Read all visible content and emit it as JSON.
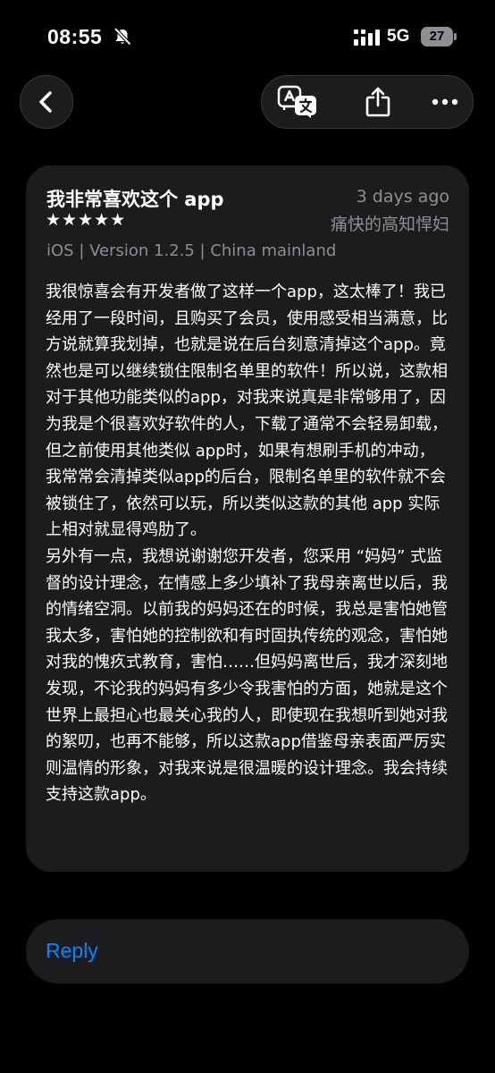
{
  "status_bar": {
    "time": "08:55",
    "network": "5G",
    "battery": "27"
  },
  "review": {
    "title": "我非常喜欢这个 app",
    "date": "3 days ago",
    "stars": "★★★★★",
    "rating": 5,
    "author": "痛快的高知悍妇",
    "meta": "iOS | Version 1.2.5 | China mainland",
    "paragraphs": [
      "我很惊喜会有开发者做了这样一个app，这太棒了！我已经用了一段时间，且购买了会员，使用感受相当满意，比方说就算我划掉，也就是说在后台刻意清掉这个app。竟然也是可以继续锁住限制名单里的软件！所以说，这款相对于其他功能类似的app，对我来说真是非常够用了，因为我是个很喜欢好软件的人，下载了通常不会轻易卸载，但之前使用其他类似 app时，如果有想刷手机的冲动，我常常会清掉类似app的后台，限制名单里的软件就不会被锁住了，依然可以玩，所以类似这款的其他 app 实际上相对就显得鸡肋了。",
      "另外有一点，我想说谢谢您开发者，您采用 “妈妈” 式监督的设计理念，在情感上多少填补了我母亲离世以后，我的情绪空洞。以前我的妈妈还在的时候，我总是害怕她管我太多，害怕她的控制欲和有时固执传统的观念，害怕她对我的愧疚式教育，害怕……但妈妈离世后，我才深刻地发现，不论我的妈妈有多少令我害怕的方面，她就是这个世界上最担心也最关心我的人，即使现在我想听到她对我的絮叨，也再不能够，所以这款app借鉴母亲表面严厉实则温情的形象，对我来说是很温暖的设计理念。我会持续支持这款app。"
    ]
  },
  "reply": {
    "label": "Reply"
  },
  "icons": {
    "back": "chevron-left-icon",
    "translate": "translate-icon",
    "share": "share-icon",
    "more": "ellipsis-icon",
    "silent": "bell-slash-icon",
    "signal": "cellular-signal-icon"
  },
  "colors": {
    "background": "#000000",
    "card": "#1c1c1e",
    "secondary_text": "#8e8e93",
    "accent": "#0a84ff"
  }
}
